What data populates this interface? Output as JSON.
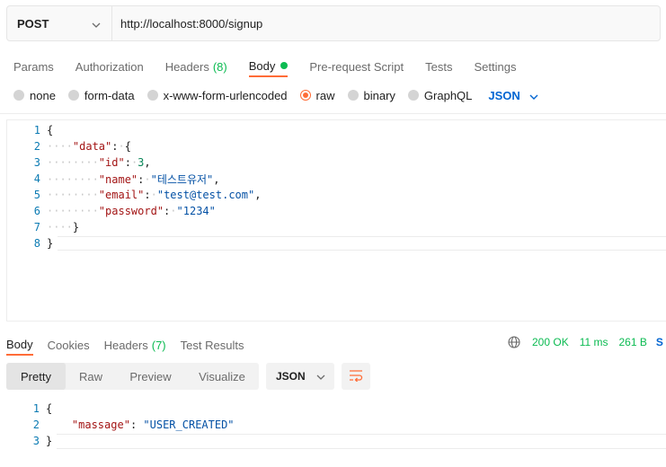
{
  "request": {
    "method": "POST",
    "url": "http://localhost:8000/signup"
  },
  "request_tabs": [
    {
      "label": "Params"
    },
    {
      "label": "Authorization"
    },
    {
      "label": "Headers",
      "count": "(8)"
    },
    {
      "label": "Body",
      "active": true
    },
    {
      "label": "Pre-request Script"
    },
    {
      "label": "Tests"
    },
    {
      "label": "Settings"
    }
  ],
  "body_types": [
    {
      "label": "none"
    },
    {
      "label": "form-data"
    },
    {
      "label": "x-www-form-urlencoded"
    },
    {
      "label": "raw",
      "selected": true
    },
    {
      "label": "binary"
    },
    {
      "label": "GraphQL"
    }
  ],
  "body_format": "JSON",
  "request_body_lines": [
    {
      "n": "1",
      "text": "{"
    },
    {
      "n": "2",
      "text": "    \"data\": {"
    },
    {
      "n": "3",
      "text": "        \"id\": 3,"
    },
    {
      "n": "4",
      "text": "        \"name\": \"테스트유저\","
    },
    {
      "n": "5",
      "text": "        \"email\": \"test@test.com\","
    },
    {
      "n": "6",
      "text": "        \"password\": \"1234\""
    },
    {
      "n": "7",
      "text": "    }"
    },
    {
      "n": "8",
      "text": "}"
    }
  ],
  "response_tabs": [
    {
      "label": "Body",
      "active": true
    },
    {
      "label": "Cookies"
    },
    {
      "label": "Headers",
      "count": "(7)"
    },
    {
      "label": "Test Results"
    }
  ],
  "response_meta": {
    "status": "200 OK",
    "time": "11 ms",
    "size": "261 B",
    "save_fragment": "S"
  },
  "response_views": [
    "Pretty",
    "Raw",
    "Preview",
    "Visualize"
  ],
  "response_format": "JSON",
  "response_body_lines": [
    {
      "n": "1",
      "text": "{"
    },
    {
      "n": "2",
      "text": "    \"massage\": \"USER_CREATED\""
    },
    {
      "n": "3",
      "text": "}"
    }
  ],
  "colors": {
    "accent": "#ff6c37",
    "success": "#0cbb52",
    "link": "#0265d2",
    "line_number": "#0c7bb3",
    "json_key": "#a31515",
    "json_string": "#0451a5",
    "json_number": "#098658"
  },
  "icons": {
    "method_dropdown": "chevron-down-icon",
    "format_dropdown": "chevron-down-icon",
    "network": "globe-icon",
    "wrap": "wrap-lines-icon"
  }
}
